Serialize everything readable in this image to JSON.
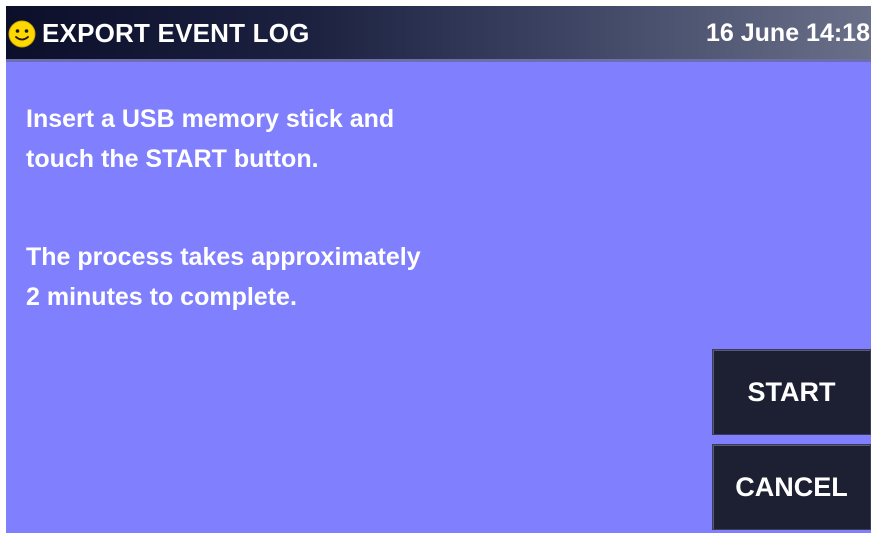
{
  "header": {
    "status_icon": "smiley-face-icon",
    "title": "EXPORT EVENT LOG",
    "datetime": "16 June 14:18"
  },
  "message": {
    "line1": "Insert a USB memory stick and",
    "line2": "touch the START button.",
    "line3": "The process takes approximately",
    "line4": "2 minutes to complete."
  },
  "buttons": {
    "start_label": "START",
    "cancel_label": "CANCEL"
  },
  "colors": {
    "background": "#8080ff",
    "titlebar_dark": "#0b0f2a",
    "button": "#1d1f33",
    "icon_yellow": "#ffd800",
    "text": "#ffffff"
  }
}
